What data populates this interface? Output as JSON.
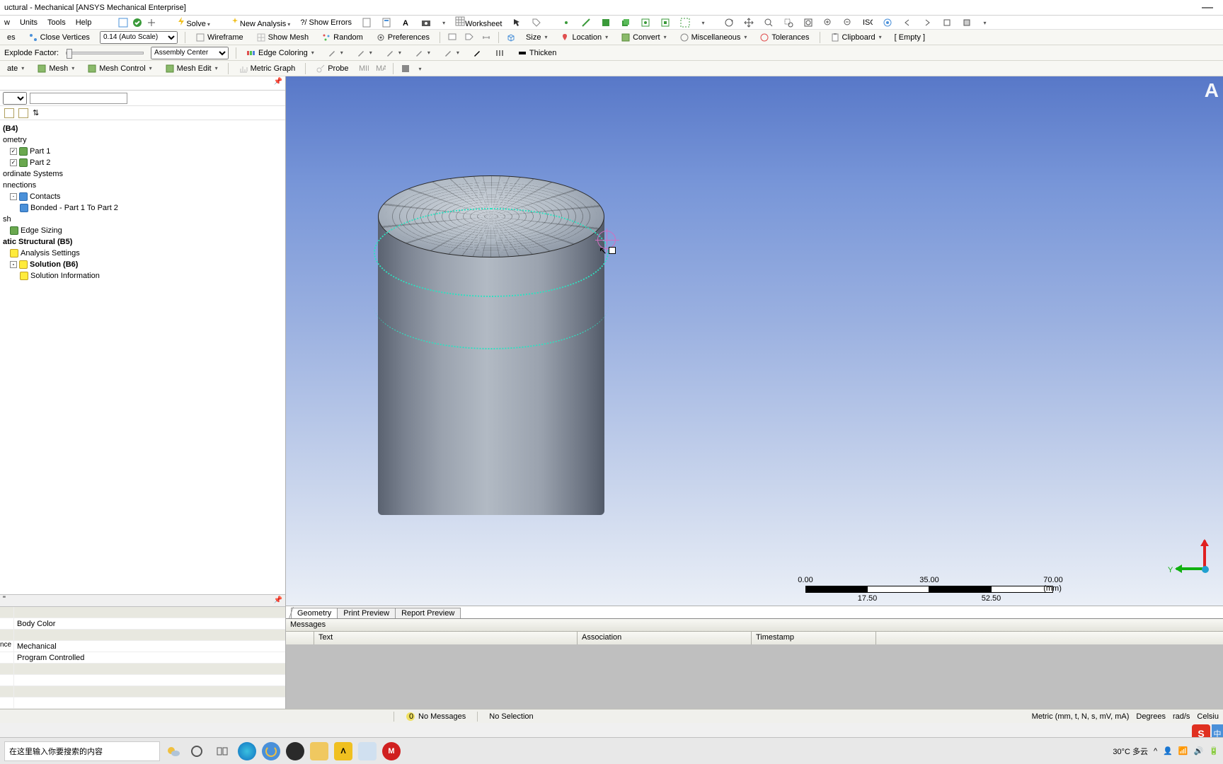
{
  "title": "uctural - Mechanical [ANSYS Mechanical Enterprise]",
  "menubar": {
    "items": [
      "w",
      "Units",
      "Tools",
      "Help"
    ]
  },
  "toolbar1": {
    "solve": "Solve",
    "new_analysis": "New Analysis",
    "show_errors": "?/ Show Errors",
    "worksheet": "Worksheet"
  },
  "toolbar2": {
    "close_vertices_label": "Close Vertices",
    "close_vertices_prefix": "es",
    "auto_scale": "0.14 (Auto Scale)",
    "wireframe": "Wireframe",
    "show_mesh": "Show Mesh",
    "random": "Random",
    "preferences": "Preferences",
    "size": "Size",
    "location": "Location",
    "convert": "Convert",
    "misc": "Miscellaneous",
    "tolerances": "Tolerances",
    "clipboard": "Clipboard",
    "empty": "[ Empty ]"
  },
  "toolbar3": {
    "explode": "Explode Factor:",
    "assembly_center": "Assembly Center",
    "edge_coloring": "Edge Coloring",
    "thicken": "Thicken"
  },
  "toolbar4": {
    "ate": "ate",
    "mesh": "Mesh",
    "mesh_control": "Mesh Control",
    "mesh_edit": "Mesh Edit",
    "metric_graph": "Metric Graph",
    "probe": "Probe"
  },
  "tree": {
    "root": "(B4)",
    "geometry": "ometry",
    "part1": "Part 1",
    "part2": "Part 2",
    "coord": "ordinate Systems",
    "connections": "nnections",
    "contacts": "Contacts",
    "bonded": "Bonded - Part 1 To Part 2",
    "mesh": "sh",
    "edge_sizing": "Edge Sizing",
    "static": "atic Structural (B5)",
    "analysis_settings": "Analysis Settings",
    "solution": "Solution (B6)",
    "solution_info": "Solution Information"
  },
  "props": {
    "body_color": "Body Color",
    "mechanical_label": "nce",
    "mechanical": "Mechanical",
    "program_controlled": "Program Controlled"
  },
  "viewport": {
    "corner": "A",
    "axis_y": "Y",
    "scale": {
      "v0": "0.00",
      "v1": "17.50",
      "v2": "35.00",
      "v3": "52.50",
      "v4": "70.00 (mm)"
    }
  },
  "tabs": {
    "geometry": "Geometry",
    "print": "Print Preview",
    "report": "Report Preview"
  },
  "messages": {
    "title": "Messages",
    "cols": {
      "text": "Text",
      "assoc": "Association",
      "ts": "Timestamp"
    }
  },
  "status": {
    "no_messages": "No Messages",
    "no_selection": "No Selection",
    "units": "Metric (mm, t, N, s, mV, mA)",
    "degrees": "Degrees",
    "rads": "rad/s",
    "celsius": "Celsiu"
  },
  "taskbar": {
    "search_placeholder": "在这里输入你要搜索的内容",
    "weather": "30°C 多云",
    "ime": "中"
  }
}
